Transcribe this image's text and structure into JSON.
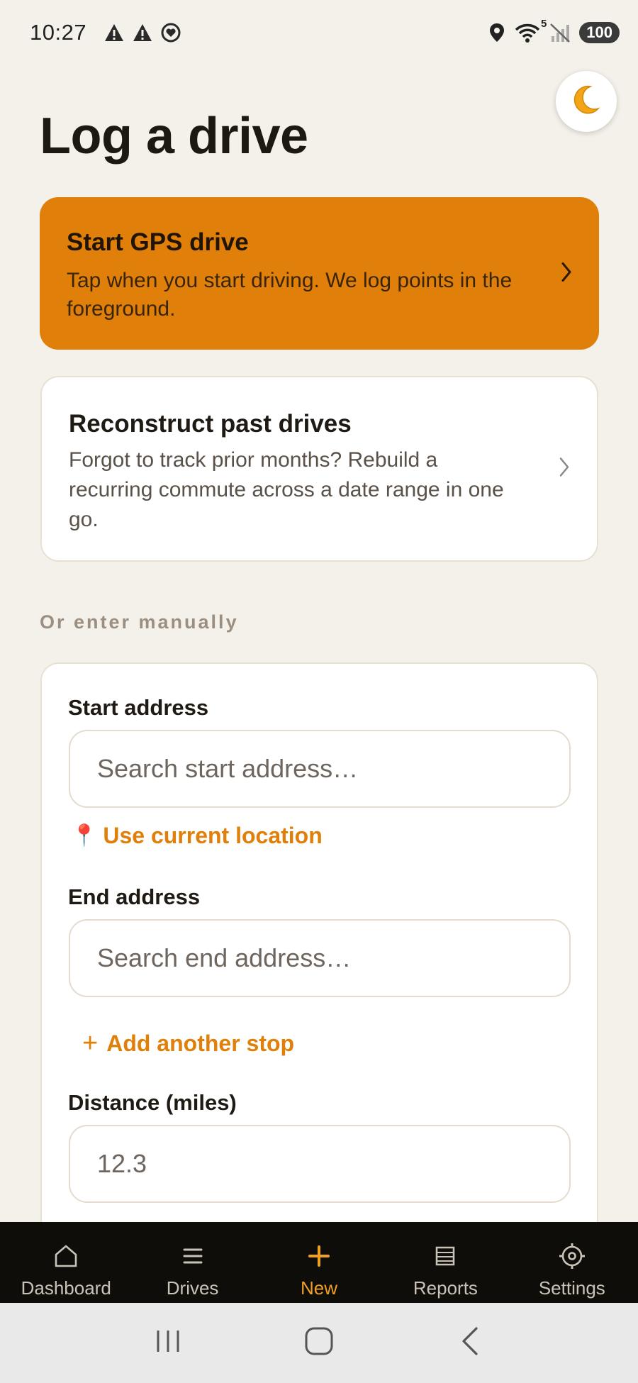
{
  "status_bar": {
    "time": "10:27",
    "wifi_badge": "5",
    "battery": "100"
  },
  "theme_toggle": {
    "icon": "moon-icon"
  },
  "page": {
    "title": "Log a drive"
  },
  "gps_card": {
    "title": "Start GPS drive",
    "description": "Tap when you start driving. We log points in the foreground."
  },
  "reconstruct_card": {
    "title": "Reconstruct past drives",
    "description": "Forgot to track prior months? Rebuild a recurring commute across a date range in one go."
  },
  "manual": {
    "section_label": "Or enter manually",
    "start_address": {
      "label": "Start address",
      "placeholder": "Search start address…",
      "value": ""
    },
    "use_location": {
      "icon": "📍",
      "label": "Use current location"
    },
    "end_address": {
      "label": "End address",
      "placeholder": "Search end address…",
      "value": ""
    },
    "add_stop": {
      "icon": "+",
      "label": "Add another stop"
    },
    "distance": {
      "label": "Distance (miles)",
      "placeholder": "12.3",
      "value": ""
    }
  },
  "bottom_nav": {
    "items": [
      {
        "label": "Dashboard",
        "icon": "home-icon"
      },
      {
        "label": "Drives",
        "icon": "list-icon"
      },
      {
        "label": "New",
        "icon": "plus-icon",
        "active": true
      },
      {
        "label": "Reports",
        "icon": "report-icon"
      },
      {
        "label": "Settings",
        "icon": "gear-icon"
      }
    ]
  },
  "colors": {
    "accent": "#e0800a",
    "background": "#f4f1ea",
    "nav_background": "#0f0d0a",
    "nav_active": "#f0a020"
  }
}
